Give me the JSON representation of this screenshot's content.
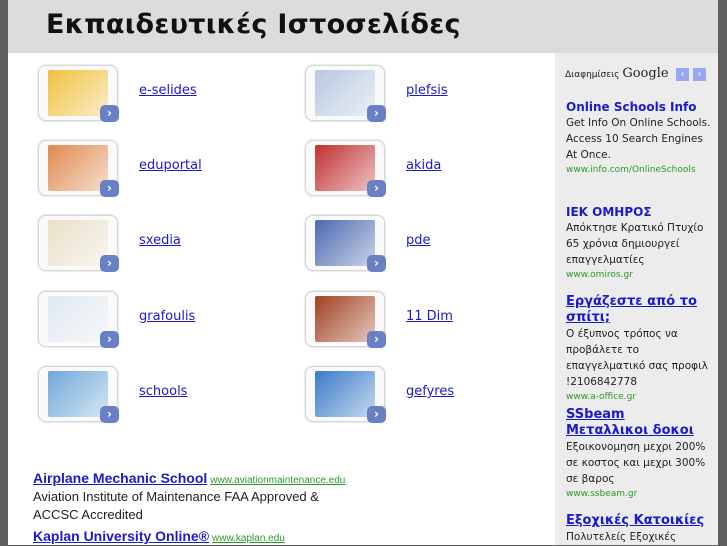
{
  "header": {
    "title": "Εκπαιδευτικές Ιστοσελίδες"
  },
  "tiles": [
    {
      "label": "e-selides",
      "color": "#f0c040"
    },
    {
      "label": "plefsis",
      "color": "#b8c8e0"
    },
    {
      "label": "eduportal",
      "color": "#e08a50"
    },
    {
      "label": "akida",
      "color": "#c03030"
    },
    {
      "label": "sxedia",
      "color": "#e8e0c8"
    },
    {
      "label": "pde",
      "color": "#4a6ab0"
    },
    {
      "label": "grafoulis",
      "color": "#e0e8f0"
    },
    {
      "label": "11 Dim",
      "color": "#a04020"
    },
    {
      "label": "schools",
      "color": "#70a8d8"
    },
    {
      "label": "gefyres",
      "color": "#3a7ac8"
    }
  ],
  "ads": [
    {
      "title": "Airplane Mechanic School",
      "url": "www.aviationmaintenance.edu",
      "desc": "Aviation Institute of Maintenance FAA Approved & ACCSC Accredited"
    },
    {
      "title": "Kaplan University Online®",
      "url": "www.kaplan.edu"
    }
  ],
  "sidebar": {
    "header_prefix": "Διαφημίσεις",
    "header_brand": "Google",
    "prev": "‹",
    "next": "›",
    "ads": [
      {
        "title": "Online Schools Info",
        "desc": "Get Info On Online Schools. Access 10 Search Engines At Once.",
        "url": "www.info.com/OnlineSchools"
      },
      {
        "title": "ΙΕΚ ΟΜΗΡΟΣ",
        "desc": "Απόκτησε Κρατικό Πτυχίο 65 χρόνια δημιουργεί επαγγελματίες",
        "url": "www.omiros.gr"
      },
      {
        "title": "Εργάζεστε από το σπίτι;",
        "desc": "Ο έξυπνος τρόπος να προβάλετε το επαγγελματικό σας προφιλ !2106842778",
        "url": "www.a-office.gr"
      },
      {
        "title": "SSbeam Μεταλλικοι δοκοι",
        "desc": "Εξοικονομηση μεχρι 200% σε κοστος και μεχρι 300% σε βαρος",
        "url": "www.ssbeam.gr"
      },
      {
        "title": "Εξοχικές Κατοικίες",
        "desc": "Πολυτελείς Εξοχικές"
      }
    ]
  }
}
